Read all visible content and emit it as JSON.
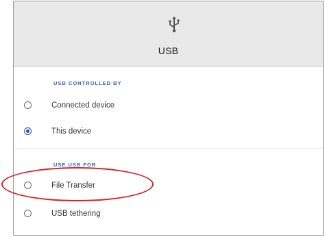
{
  "header": {
    "title": "USB",
    "icon": "usb-icon"
  },
  "controlled_by": {
    "section_label": "USB CONTROLLED BY",
    "options": [
      {
        "label": "Connected device",
        "selected": false
      },
      {
        "label": "This device",
        "selected": true
      }
    ]
  },
  "use_for": {
    "section_label": "USE USB FOR",
    "options": [
      {
        "label": "File Transfer",
        "selected": false
      },
      {
        "label": "USB tethering",
        "selected": false
      }
    ]
  },
  "colors": {
    "accent": "#2a4fb8",
    "header_bg": "#e9e9e9",
    "highlight": "#d6202a"
  }
}
